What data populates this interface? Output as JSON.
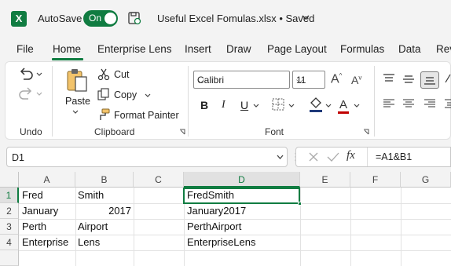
{
  "titlebar": {
    "logo": "X",
    "autosave_label": "AutoSave",
    "toggle_label": "On",
    "document_title": "Useful Excel Fomulas.xlsx • Saved",
    "save_icon": "save-sync-icon"
  },
  "tabs": [
    "File",
    "Home",
    "Enterprise Lens",
    "Insert",
    "Draw",
    "Page Layout",
    "Formulas",
    "Data",
    "Rev"
  ],
  "active_tab": "Home",
  "ribbon": {
    "groups": {
      "undo": "Undo",
      "clipboard": "Clipboard",
      "font": "Font"
    },
    "paste_label": "Paste",
    "cut_label": "Cut",
    "copy_label": "Copy",
    "format_painter_label": "Format Painter",
    "font_name": "Calibri",
    "font_size": "11",
    "bold": "B",
    "italic": "I",
    "underline": "U"
  },
  "formula_bar": {
    "name_box": "D1",
    "formula": "=A1&B1",
    "fx": "fx"
  },
  "sheet": {
    "columns": [
      "A",
      "B",
      "C",
      "D",
      "E",
      "F",
      "G"
    ],
    "rows": [
      "1",
      "2",
      "3",
      "4"
    ],
    "cells": {
      "A1": "Fred",
      "B1": "Smith",
      "D1": "FredSmith",
      "A2": "January",
      "B2": "2017",
      "D2": "January2017",
      "A3": "Perth",
      "B3": "Airport",
      "D3": "PerthAirport",
      "A4": "Enterprise",
      "B4": "Lens",
      "D4": "EnterpriseLens"
    },
    "active_cell": "D1"
  },
  "colors": {
    "accent": "#107c41",
    "background": "#f3f3f3"
  }
}
